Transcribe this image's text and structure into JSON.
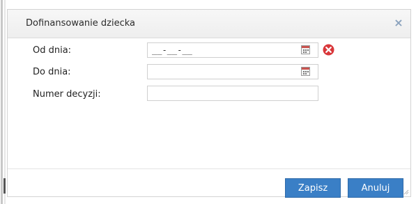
{
  "dialog": {
    "title": "Dofinansowanie dziecka",
    "close_symbol": "×"
  },
  "form": {
    "from_date": {
      "label": "Od dnia:",
      "value": "__-__-__",
      "calendar_icon": "calendar-icon",
      "clear_icon": "clear-red-icon"
    },
    "to_date": {
      "label": "Do dnia:",
      "value": "",
      "calendar_icon": "calendar-icon"
    },
    "decision_number": {
      "label": "Numer decyzji:",
      "value": ""
    }
  },
  "buttons": {
    "save_label": "Zapisz",
    "cancel_label": "Anuluj"
  },
  "colors": {
    "button_blue": "#3a7fc6",
    "clear_red": "#d9373a",
    "close_x": "#8aa2bd"
  }
}
